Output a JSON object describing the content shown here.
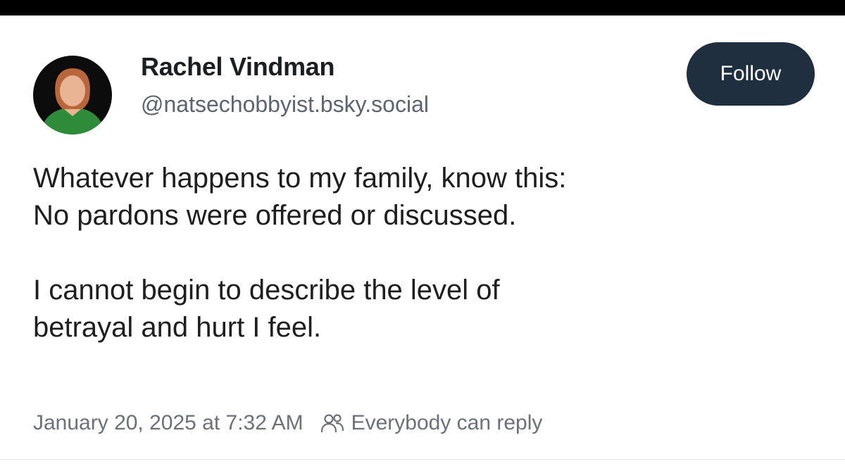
{
  "author": {
    "name": "Rachel Vindman",
    "handle": "@natsechobbyist.bsky.social"
  },
  "follow_button": {
    "label": "Follow"
  },
  "post": {
    "paragraphs": [
      {
        "lines": [
          "Whatever happens to my family, know this:",
          "No pardons were offered or discussed."
        ]
      },
      {
        "lines": [
          "I cannot begin to describe the level of",
          "betrayal and hurt I feel."
        ]
      }
    ],
    "timestamp": "January 20, 2025 at 7:32 AM",
    "reply_setting": "Everybody can reply",
    "reply_icon": "people-icon"
  },
  "colors": {
    "follow_button_bg": "#1f2f40",
    "avatar_shirt": "#2e8b3a",
    "text_primary": "#1e1e1e",
    "text_secondary": "#6a717a"
  }
}
